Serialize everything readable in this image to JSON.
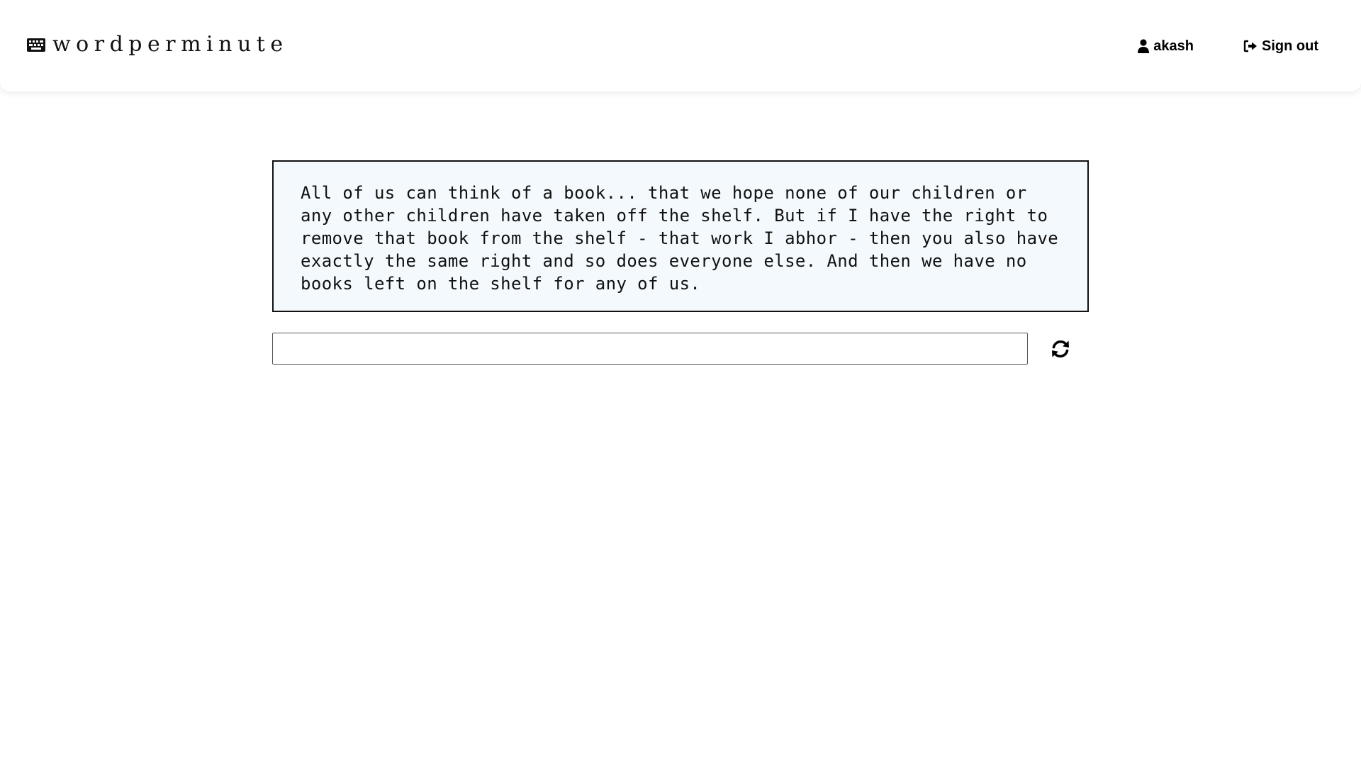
{
  "header": {
    "brand": {
      "icon": "keyboard-icon",
      "text": "wordperminute"
    },
    "user": {
      "icon": "user-icon",
      "label": "akash"
    },
    "signout": {
      "icon": "sign-out-icon",
      "label": "Sign out"
    }
  },
  "main": {
    "quote": "All of us can think of a book... that we hope none of our children or any other children have taken off the shelf. But if I have the right to remove that book from the shelf - that work I abhor - then you also have exactly the same right and so does everyone else. And then we have no books left on the shelf for any of us.",
    "input": {
      "value": "",
      "placeholder": ""
    },
    "refresh_icon": "refresh-icon"
  },
  "colors": {
    "quote_background": "#f4f9fd",
    "border": "#111111",
    "text": "#000000"
  }
}
